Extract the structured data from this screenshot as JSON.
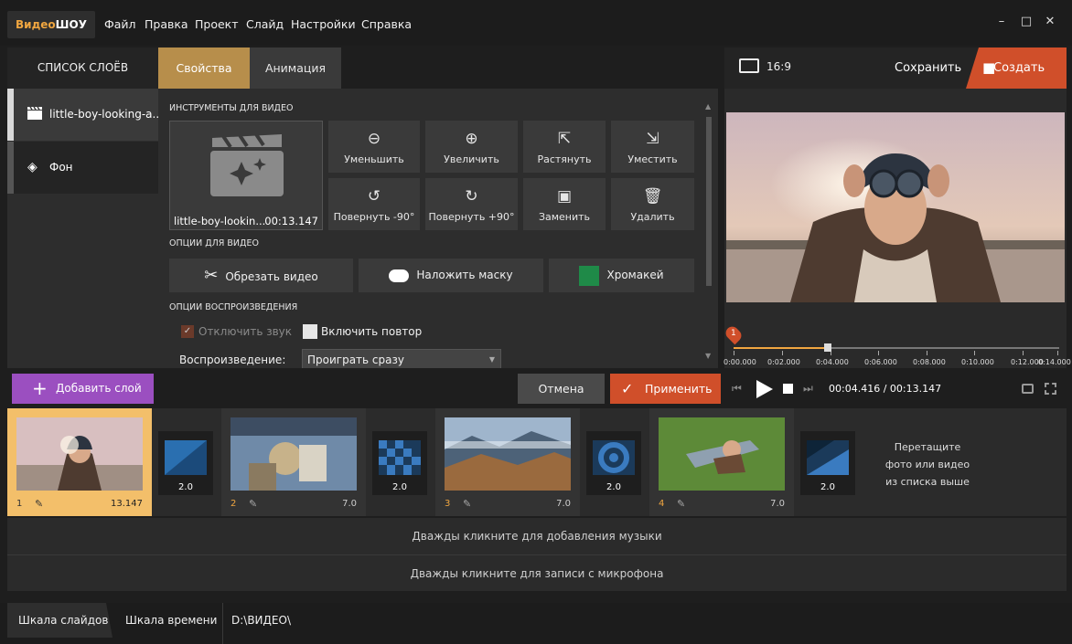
{
  "app": {
    "logo_part1": "Видео",
    "logo_part2": "ШОУ",
    "menu": [
      "Файл",
      "Правка",
      "Проект",
      "Слайд",
      "Настройки",
      "Справка"
    ],
    "window": {
      "minimize": "–",
      "maximize": "□",
      "close": "✕"
    }
  },
  "layers": {
    "header": "СПИСОК СЛОЁВ",
    "items": [
      {
        "label": "little-boy-looking-a...",
        "icon": "clapperboard-icon"
      },
      {
        "label": "Фон",
        "icon": "paint-bucket-icon"
      }
    ]
  },
  "tabs": {
    "properties": "Свойства",
    "animation": "Анимация"
  },
  "tools": {
    "title": "ИНСТРУМЕНТЫ ДЛЯ ВИДЕО",
    "clip_name": "little-boy-lookin...",
    "clip_duration": "00:13.147",
    "buttons": [
      {
        "label": "Уменьшить",
        "glyph": "⊖"
      },
      {
        "label": "Увеличить",
        "glyph": "⊕"
      },
      {
        "label": "Растянуть",
        "glyph": "⇱"
      },
      {
        "label": "Уместить",
        "glyph": "⇲"
      },
      {
        "label": "Повернуть -90°",
        "glyph": "↺"
      },
      {
        "label": "Повернуть +90°",
        "glyph": "↻"
      },
      {
        "label": "Заменить",
        "glyph": "▣"
      },
      {
        "label": "Удалить",
        "glyph": "🗑"
      }
    ]
  },
  "video_options": {
    "title": "ОПЦИИ ДЛЯ ВИДЕО",
    "trim": "Обрезать видео",
    "mask": "Наложить маску",
    "chromakey": "Хромакей",
    "chromakey_color": "#1f8a48"
  },
  "playback": {
    "title": "ОПЦИИ ВОСПРОИЗВЕДЕНИЯ",
    "mute": "Отключить звук",
    "loop": "Включить повтор",
    "mode_label": "Воспроизведение:",
    "mode_value": "Проиграть сразу"
  },
  "preview": {
    "aspect": "16:9",
    "save": "Сохранить",
    "create": "Создать",
    "marker": "1",
    "ticks": [
      "0:00.000",
      "0:02.000",
      "0:04.000",
      "0:06.000",
      "0:08.000",
      "0:10.000",
      "0:12.000",
      "0:14.000"
    ],
    "playhead_fraction": 0.315,
    "time_current": "00:04.416",
    "time_sep": " / ",
    "time_total": "00:13.147"
  },
  "actions": {
    "add_layer": "Добавить слой",
    "cancel": "Отмена",
    "apply": "Применить"
  },
  "slides": [
    {
      "num": "1",
      "duration": "13.147"
    },
    {
      "num": "2",
      "duration": "7.0"
    },
    {
      "num": "3",
      "duration": "7.0"
    },
    {
      "num": "4",
      "duration": "7.0"
    }
  ],
  "transitions": [
    "2.0",
    "2.0",
    "2.0",
    "2.0"
  ],
  "drop_hint_1": "Перетащите",
  "drop_hint_2": "фото или видео",
  "drop_hint_3": "из списка выше",
  "tracks": {
    "music": "Дважды кликните для добавления музыки",
    "mic": "Дважды кликните для записи с микрофона"
  },
  "bottom": {
    "slides_tab": "Шкала слайдов",
    "timeline_tab": "Шкала времени",
    "path": "D:\\ВИДЕО\\"
  }
}
